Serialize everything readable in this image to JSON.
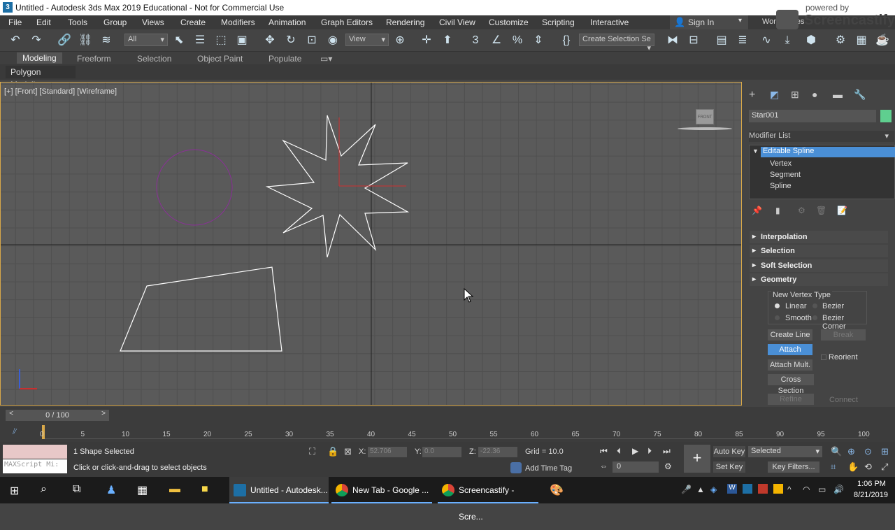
{
  "window": {
    "title": "Untitled - Autodesk 3ds Max 2019 Educational - Not for Commercial Use"
  },
  "menu": [
    "File",
    "Edit",
    "Tools",
    "Group",
    "Views",
    "Create",
    "Modifiers",
    "Animation",
    "Graph Editors",
    "Rendering",
    "Civil View",
    "Customize",
    "Scripting",
    "Interactive"
  ],
  "signin": "Sign In",
  "workspace": "Workspaces",
  "watermark": {
    "line1": "powered by",
    "line2": "Screencastify"
  },
  "toolbar": {
    "filter": "All",
    "refcoord": "View",
    "selection_set": "Create Selection Se"
  },
  "ribbon": {
    "tabs": [
      "Modeling",
      "Freeform",
      "Selection",
      "Object Paint",
      "Populate"
    ],
    "sub": "Polygon Modeling"
  },
  "viewport": {
    "label": "[+] [Front] [Standard] [Wireframe]",
    "viewcube": "FRONT"
  },
  "panel": {
    "object_name": "Star001",
    "modifier_list": "Modifier List",
    "stack": [
      "Editable Spline",
      "Vertex",
      "Segment",
      "Spline"
    ],
    "rollouts": [
      "Interpolation",
      "Selection",
      "Soft Selection",
      "Geometry"
    ],
    "geometry": {
      "new_vertex_type": "New Vertex Type",
      "linear": "Linear",
      "bezier": "Bezier",
      "smooth": "Smooth",
      "bezier_corner": "Bezier Corner",
      "create_line": "Create Line",
      "break": "Break",
      "attach": "Attach",
      "reorient": "Reorient",
      "attach_mult": "Attach Mult.",
      "cross_section": "Cross Section",
      "refine": "Refine",
      "connect": "Connect"
    }
  },
  "timeline": {
    "frame": "0 / 100",
    "ticks": [
      "0",
      "5",
      "10",
      "15",
      "20",
      "25",
      "30",
      "35",
      "40",
      "45",
      "50",
      "55",
      "60",
      "65",
      "70",
      "75",
      "80",
      "85",
      "90",
      "95",
      "100"
    ]
  },
  "status": {
    "maxscript": "MAXScript Mi:",
    "selected": "1 Shape Selected",
    "prompt": "Click or click-and-drag to select objects",
    "x_label": "X:",
    "x": "52.706",
    "y_label": "Y:",
    "y": "0.0",
    "z_label": "Z:",
    "z": "-22.36",
    "grid": "Grid = 10.0",
    "add_time_tag": "Add Time Tag",
    "auto_key": "Auto Key",
    "set_key": "Set Key",
    "key_mode": "Selected",
    "key_filters": "Key Filters...",
    "frame_field": "0"
  },
  "taskbar": {
    "items": [
      "Untitled - Autodesk...",
      "New Tab - Google ...",
      "Screencastify - Scre..."
    ],
    "time": "1:06 PM",
    "date": "8/21/2019"
  },
  "colors": {
    "accent": "#4a8fd6",
    "viewport_border": "#d8a84a",
    "object_color": "#5fcf8f"
  }
}
